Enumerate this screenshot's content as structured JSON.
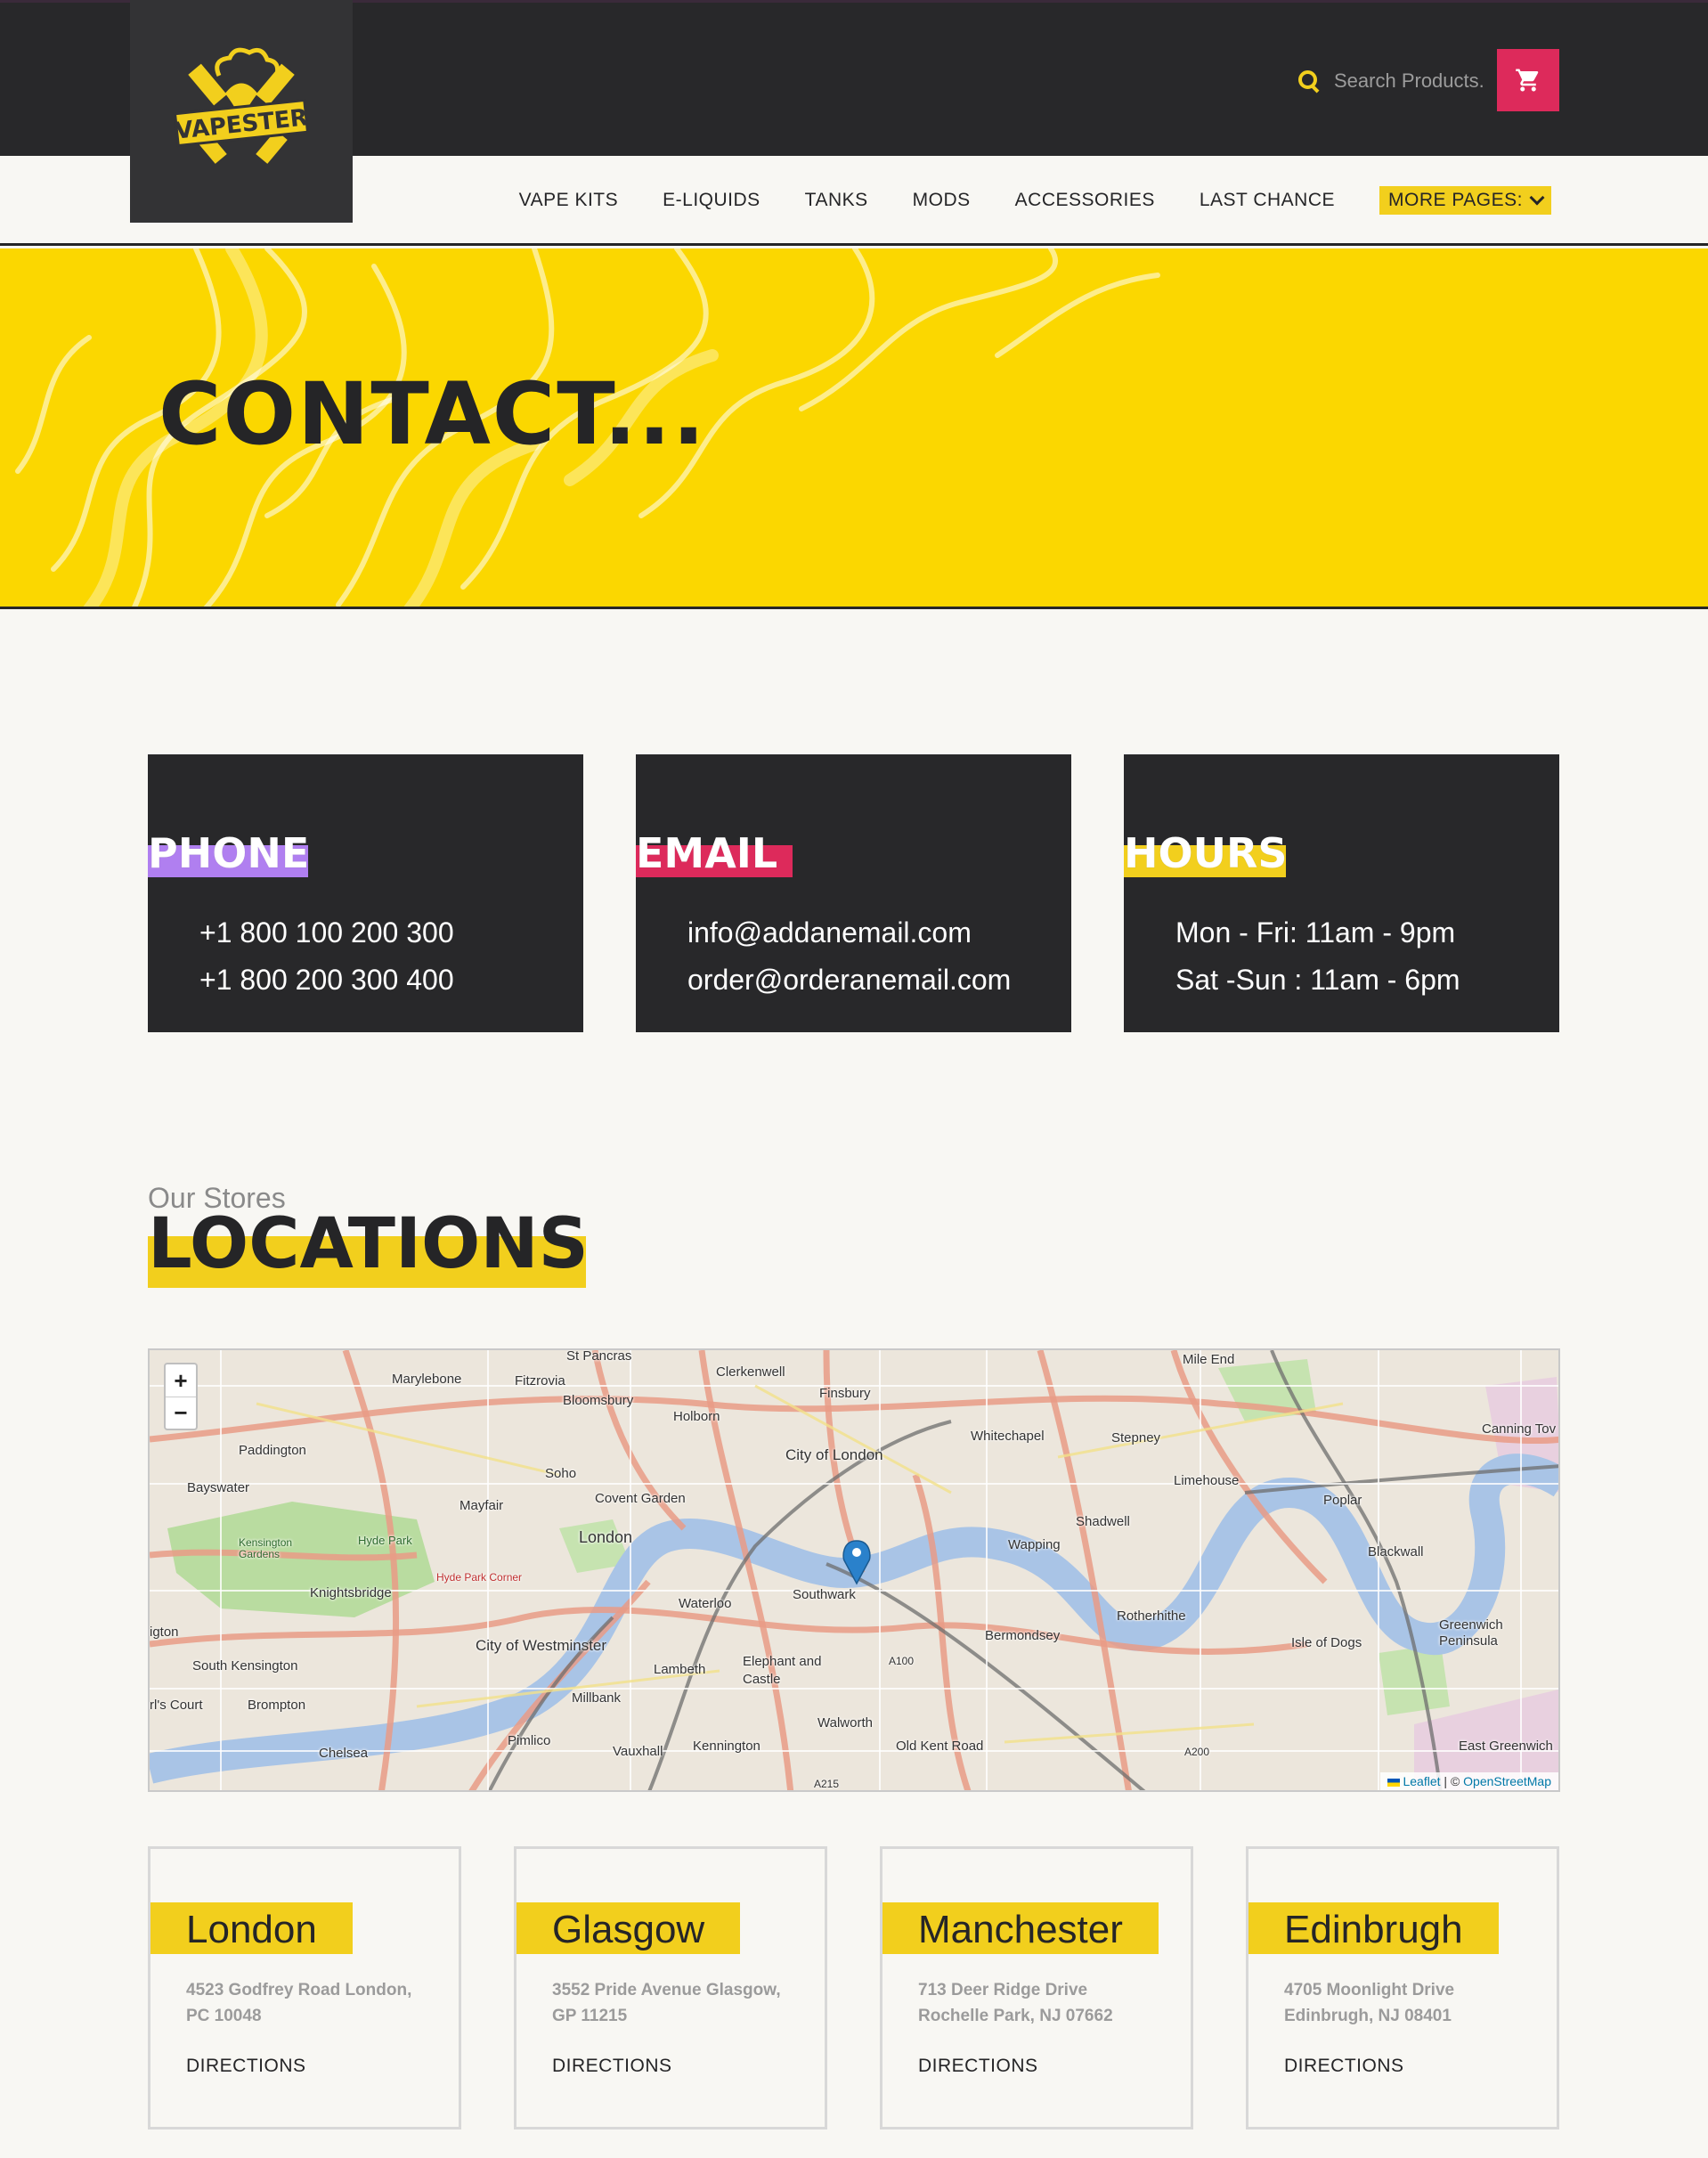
{
  "header": {
    "logo_text": "VAPESTER",
    "search_placeholder": "Search Products...",
    "cart_icon": "cart-icon"
  },
  "nav": {
    "items": [
      "VAPE KITS",
      "E-LIQUIDS",
      "TANKS",
      "MODS",
      "ACCESSORIES",
      "LAST CHANCE"
    ],
    "more_label": "MORE PAGES:"
  },
  "hero": {
    "title": "CONTACT..."
  },
  "cards": [
    {
      "tag": "PHONE",
      "color": "#b07ff0",
      "lines": [
        "+1 800 100 200 300",
        "+1 800 200 300 400"
      ]
    },
    {
      "tag": "EMAIL",
      "color": "#dd2a5b",
      "lines": [
        "info@addanemail.com",
        "order@orderanemail.com"
      ]
    },
    {
      "tag": "HOURS",
      "color": "#f2cf1d",
      "lines": [
        "Mon - Fri: 11am - 9pm",
        "Sat -Sun : 11am - 6pm"
      ]
    }
  ],
  "locations": {
    "kicker": "Our Stores",
    "title": "LOCATIONS"
  },
  "map": {
    "zoom_in": "+",
    "zoom_out": "−",
    "attribution_leaflet": "Leaflet",
    "attribution_sep": " | © ",
    "attribution_osm": "OpenStreetMap",
    "labels": [
      "St Pancras",
      "Marylebone",
      "Fitzrovia",
      "Clerkenwell",
      "Finsbury",
      "Mile End",
      "Bloomsbury",
      "Holborn",
      "Paddington",
      "City of London",
      "Whitechapel",
      "Stepney",
      "Canning Tov",
      "Bayswater",
      "Soho",
      "Limehouse",
      "Covent Garden",
      "Mayfair",
      "Poplar",
      "London",
      "Shadwell",
      "Wapping",
      "Hyde Park",
      "Kensington Gardens",
      "Blackwall",
      "Hyde Park Corner",
      "Knightsbridge",
      "Waterloo",
      "Southwark",
      "Rotherhithe",
      "Bermondsey",
      "Greenwich Peninsula",
      "igton",
      "City of Westminster",
      "Isle of Dogs",
      "South Kensington",
      "Lambeth",
      "Elephant and Castle",
      "A100",
      "rl's Court",
      "Brompton",
      "Millbank",
      "Walworth",
      "Chelsea",
      "Pimlico",
      "Vauxhall",
      "Kennington",
      "Old Kent Road",
      "A200",
      "East Greenwich",
      "A215"
    ]
  },
  "stores": [
    {
      "name": "London",
      "address": [
        "4523 Godfrey Road London,",
        "PC 10048"
      ],
      "link": "DIRECTIONS"
    },
    {
      "name": "Glasgow",
      "address": [
        "3552 Pride Avenue Glasgow,",
        "GP 11215"
      ],
      "link": "DIRECTIONS"
    },
    {
      "name": "Manchester",
      "address": [
        "713 Deer Ridge Drive",
        "Rochelle Park, NJ 07662"
      ],
      "link": "DIRECTIONS"
    },
    {
      "name": "Edinbrugh",
      "address": [
        "4705 Moonlight Drive",
        "Edinbrugh, NJ 08401"
      ],
      "link": "DIRECTIONS"
    }
  ]
}
